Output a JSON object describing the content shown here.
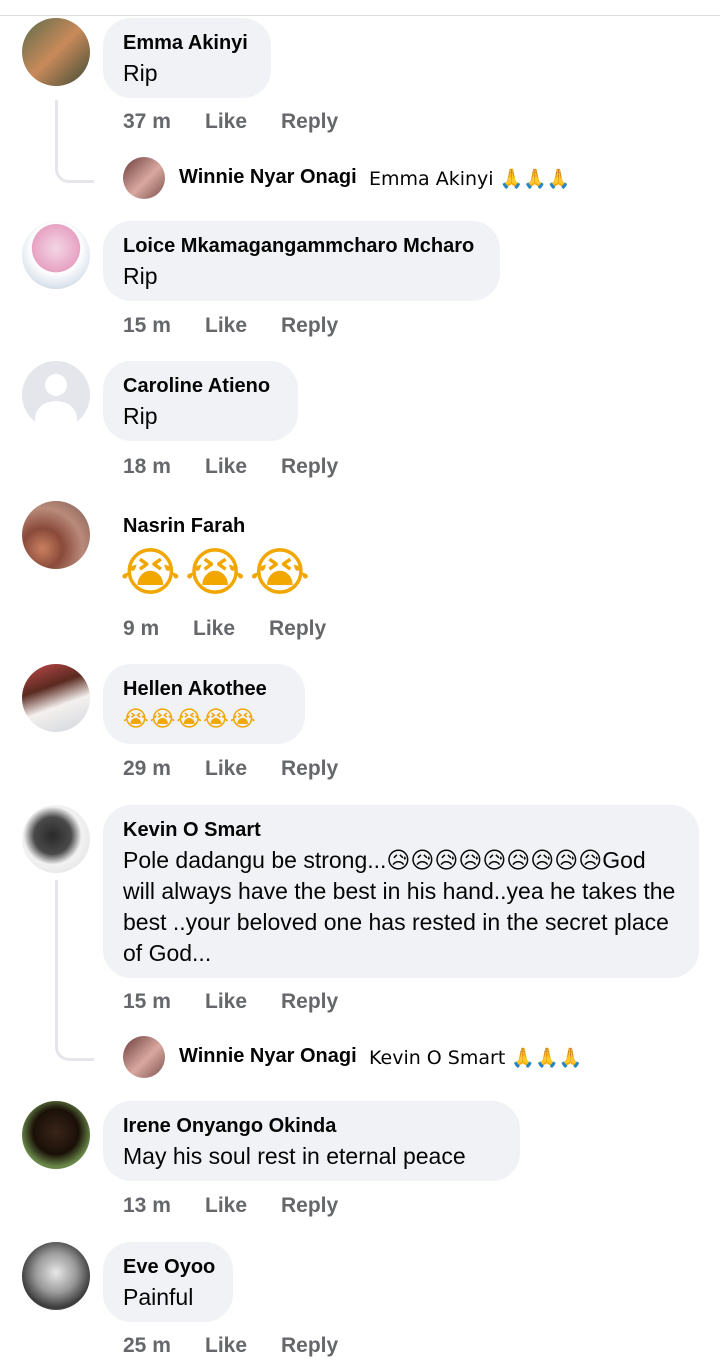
{
  "comments": [
    {
      "name": "Emma Akinyi",
      "text": "Rip",
      "time": "37 m",
      "like": "Like",
      "reply": "Reply"
    },
    {
      "name": "Loice Mkamagangammcharo Mcharo",
      "text": "Rip",
      "time": "15 m",
      "like": "Like",
      "reply": "Reply"
    },
    {
      "name": "Caroline Atieno",
      "text": "Rip",
      "time": "18 m",
      "like": "Like",
      "reply": "Reply"
    },
    {
      "name": "Nasrin Farah",
      "text": "😭😭😭",
      "time": "9 m",
      "like": "Like",
      "reply": "Reply"
    },
    {
      "name": "Hellen Akothee",
      "text": "😭😭😭😭😭",
      "time": "29 m",
      "like": "Like",
      "reply": "Reply"
    },
    {
      "name": "Kevin O Smart",
      "text": "Pole dadangu be strong...😥😥😥😥😥😥😥😥😥God will always have the best in his hand..yea he takes the best ..your beloved one has rested in the secret place of God...",
      "time": "15 m",
      "like": "Like",
      "reply": "Reply"
    },
    {
      "name": "Irene Onyango Okinda",
      "text": "May his soul rest in eternal peace",
      "time": "13 m",
      "like": "Like",
      "reply": "Reply"
    },
    {
      "name": "Eve Oyoo",
      "text": "Painful",
      "time": "25 m",
      "like": "Like",
      "reply": "Reply"
    }
  ],
  "replies": [
    {
      "name": "Winnie Nyar Onagi",
      "text": "Emma Akinyi 🙏🙏🙏"
    },
    {
      "name": "Winnie Nyar Onagi",
      "text": "Kevin O Smart 🙏🙏🙏"
    }
  ],
  "colors": {
    "bubble": "#f0f2f5",
    "meta": "#65676b",
    "text": "#050505"
  }
}
